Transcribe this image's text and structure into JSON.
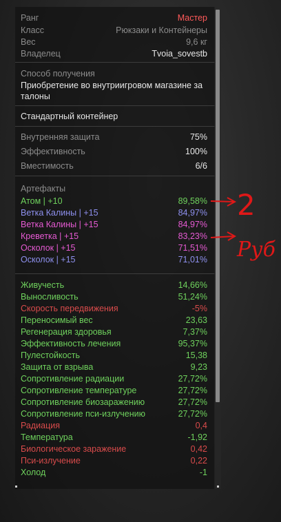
{
  "info": {
    "rank": {
      "label": "Ранг",
      "value": "Мастер"
    },
    "class": {
      "label": "Класс",
      "value": "Рюкзаки и Контейнеры"
    },
    "weight": {
      "label": "Вес",
      "value": "9,6 кг"
    },
    "owner": {
      "label": "Владелец",
      "value": "Tvoia_sovestb"
    }
  },
  "obtain": {
    "label": "Способ получения",
    "line1": "Приобретение во внутриигровом магазине за",
    "line2": "талоны"
  },
  "container_type": "Стандартный контейнер",
  "stats": [
    {
      "label": "Внутренняя защита",
      "value": "75%"
    },
    {
      "label": "Эффективность",
      "value": "100%"
    },
    {
      "label": "Вместимость",
      "value": "6/6"
    }
  ],
  "artifacts": {
    "title": "Артефакты",
    "items": [
      {
        "name": "Атом | +10",
        "value": "89,58%",
        "color": "#6fd25d"
      },
      {
        "name": "Ветка Калины | +15",
        "value": "84,97%",
        "color": "#8e90ee"
      },
      {
        "name": "Ветка Калины | +15",
        "value": "84,97%",
        "color": "#e65ad3"
      },
      {
        "name": "Креветка | +15",
        "value": "83,23%",
        "color": "#e65ad3"
      },
      {
        "name": "Осколок | +15",
        "value": "71,51%",
        "color": "#e65ad3"
      },
      {
        "name": "Осколок | +15",
        "value": "71,01%",
        "color": "#8e90ee"
      }
    ]
  },
  "effects": [
    {
      "name": "Живучесть",
      "value": "14,66%",
      "color": "#6fd25d"
    },
    {
      "name": "Выносливость",
      "value": "51,24%",
      "color": "#6fd25d"
    },
    {
      "name": "Скорость передвижения",
      "value": "-5%",
      "color": "#d94b4b"
    },
    {
      "name": "Переносимый вес",
      "value": "23,63",
      "color": "#6fd25d"
    },
    {
      "name": "Регенерация здоровья",
      "value": "7,37%",
      "color": "#6fd25d"
    },
    {
      "name": "Эффективность лечения",
      "value": "95,37%",
      "color": "#6fd25d"
    },
    {
      "name": "Пулестойкость",
      "value": "15,38",
      "color": "#6fd25d"
    },
    {
      "name": "Защита от взрыва",
      "value": "9,23",
      "color": "#6fd25d"
    },
    {
      "name": "Сопротивление радиации",
      "value": "27,72%",
      "color": "#6fd25d"
    },
    {
      "name": "Сопротивление температуре",
      "value": "27,72%",
      "color": "#6fd25d"
    },
    {
      "name": "Сопротивление биозаражению",
      "value": "27,72%",
      "color": "#6fd25d"
    },
    {
      "name": "Сопротивление пси-излучению",
      "value": "27,72%",
      "color": "#6fd25d"
    },
    {
      "name": "Радиация",
      "value": "0,4",
      "color": "#d94b4b"
    },
    {
      "name": "Температура",
      "value": "-1,92",
      "color": "#6fd25d"
    },
    {
      "name": "Биологическое заражение",
      "value": "0,42",
      "color": "#d94b4b"
    },
    {
      "name": "Пси-излучение",
      "value": "0,22",
      "color": "#d94b4b"
    },
    {
      "name": "Холод",
      "value": "-1",
      "color": "#6fd25d"
    }
  ],
  "annotations": {
    "note1": "2",
    "note2": "Руб"
  }
}
